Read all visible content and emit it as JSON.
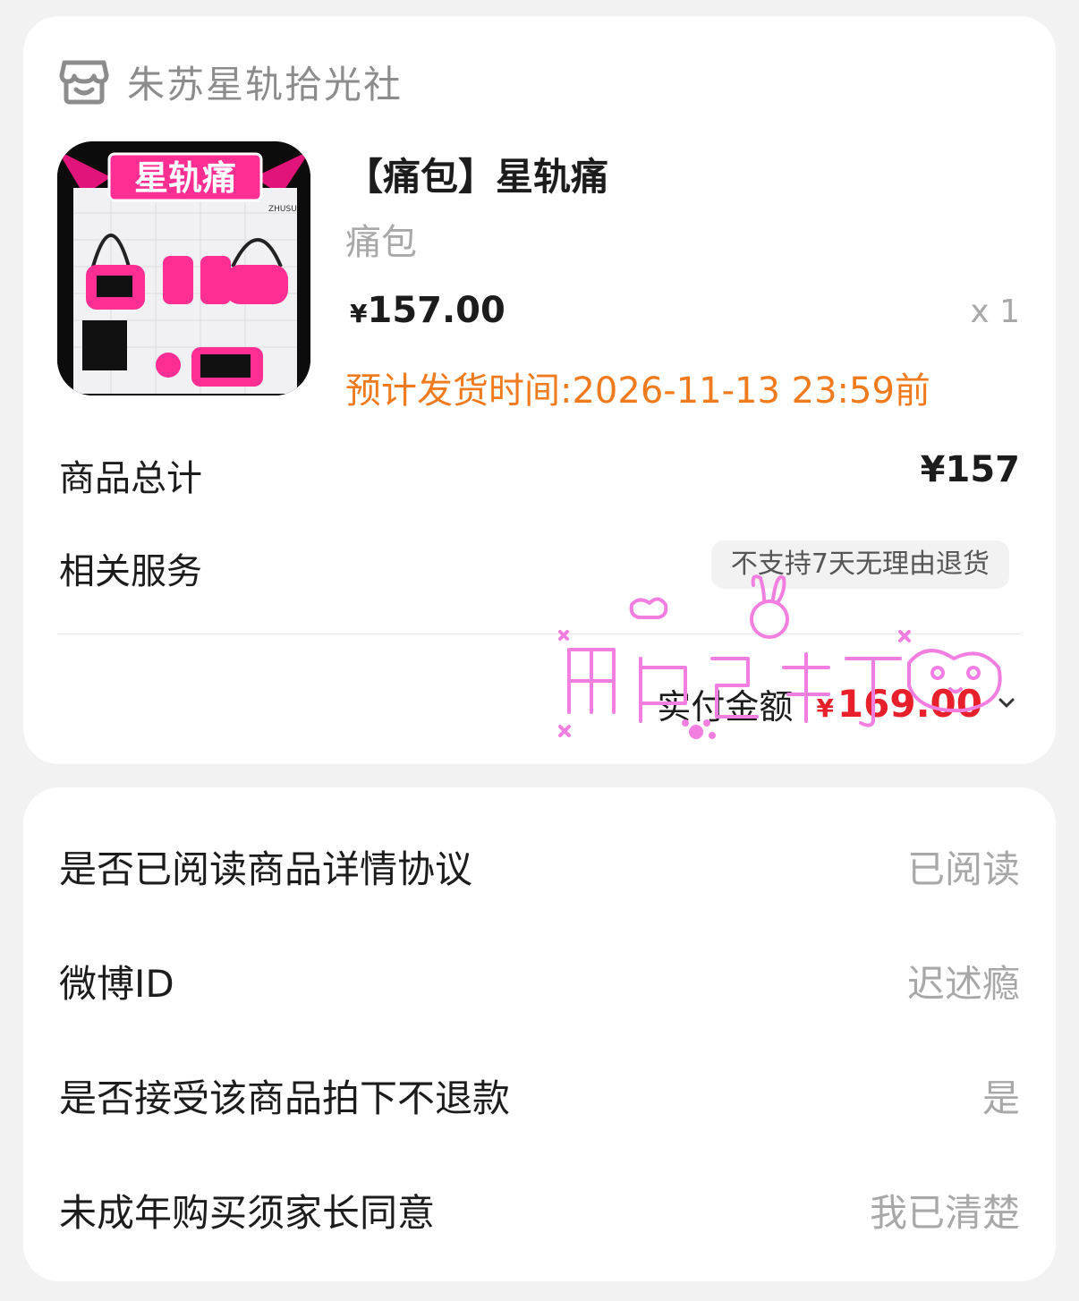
{
  "shop": {
    "name": "朱苏星轨拾光社",
    "icon": "shop-icon"
  },
  "product": {
    "title": "【痛包】星轨痛",
    "category": "痛包",
    "price_symbol": "¥",
    "price": "157.00",
    "quantity": "x 1",
    "shipping": "预计发货时间:2026-11-13 23:59前",
    "image_text": "星轨痛",
    "image_brand": "ZHUSU"
  },
  "summary": {
    "total_label": "商品总计",
    "total_value": "¥157",
    "service_label": "相关服务",
    "service_badge": "不支持7天无理由退货",
    "paid_label": "实付金额",
    "paid_symbol": "¥",
    "paid_value": "169.00"
  },
  "form": {
    "rows": [
      {
        "label": "是否已阅读商品详情协议",
        "value": "已阅读"
      },
      {
        "label": "微博ID",
        "value": "迟述瘾"
      },
      {
        "label": "是否接受该商品拍下不退款",
        "value": "是"
      },
      {
        "label": "未成年购买须家长同意",
        "value": "我已清楚"
      }
    ]
  },
  "watermark": {
    "text": "用户已布丁"
  },
  "colors": {
    "accent_orange": "#f07a1e",
    "price_red": "#e8202c",
    "watermark_pink": "#f27ee0"
  }
}
